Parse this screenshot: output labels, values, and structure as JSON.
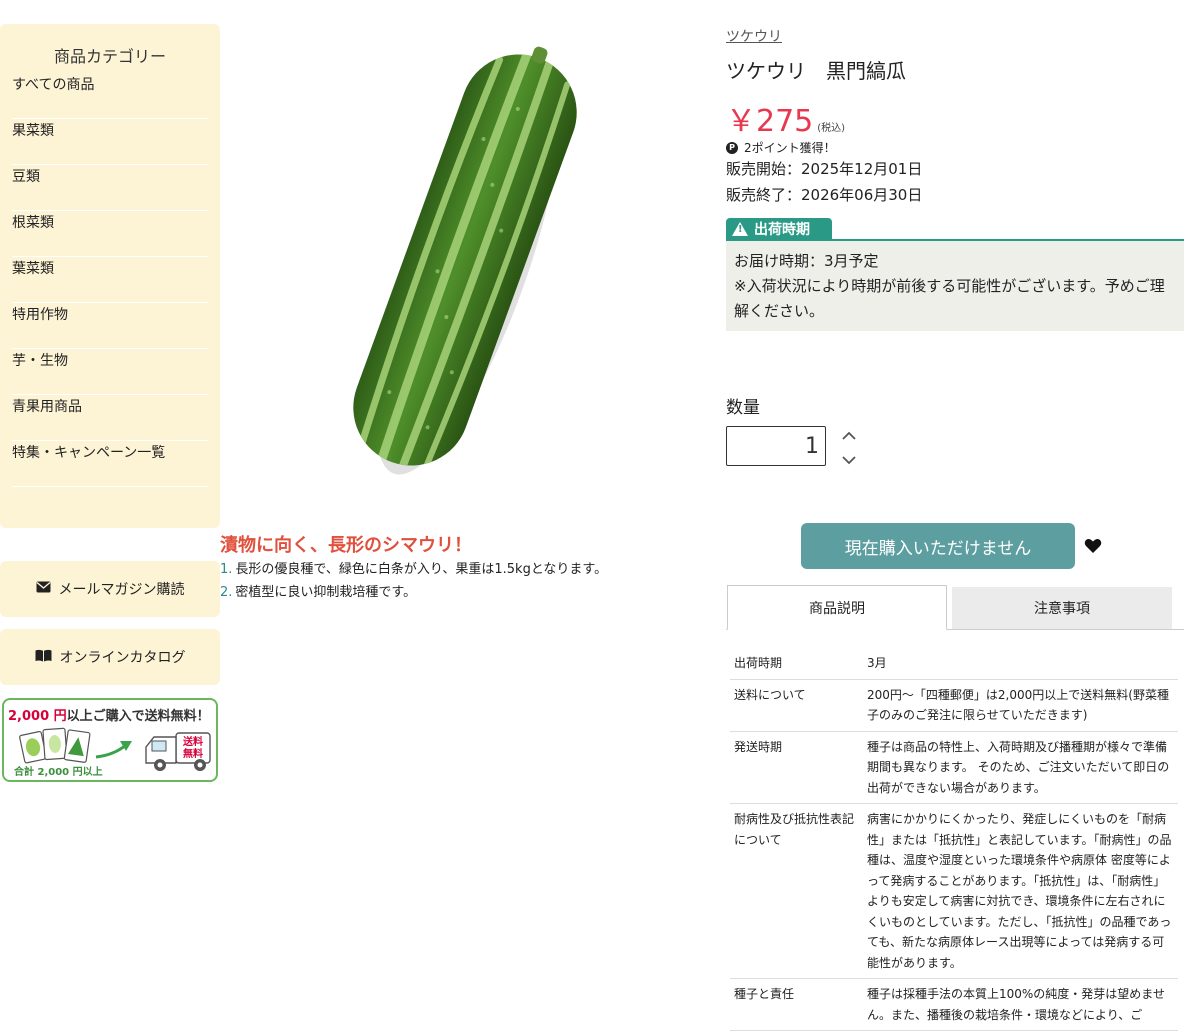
{
  "sidebar": {
    "title": "商品カテゴリー",
    "categories": [
      "すべての商品",
      "果菜類",
      "豆類",
      "根菜類",
      "葉菜類",
      "特用作物",
      "芋・生物",
      "青果用商品",
      "特集・キャンペーン一覧"
    ],
    "newsletter_label": "メールマガジン購読",
    "catalog_label": "オンラインカタログ",
    "banner": {
      "amount": "2,000 円",
      "text": "以上ご購入で送料無料！",
      "truck_text_1": "送料",
      "truck_text_2": "無料",
      "sub": "合計 2,000 円以上"
    }
  },
  "product": {
    "breadcrumb": "ツケウリ",
    "title": "ツケウリ　黒門縞瓜",
    "price": "￥275",
    "tax_note": "(税込)",
    "points": "2ポイント獲得！",
    "points_icon": "P",
    "sale_start": "販売開始：2025年12月01日",
    "sale_end": "販売終了：2026年06月30日",
    "shipping_tab": "出荷時期",
    "delivery_line1": "お届け時期：3月予定",
    "delivery_line2": "※入荷状況により時期が前後する可能性がございます。予めご理解ください。",
    "quantity_label": "数量",
    "quantity_value": "1",
    "buy_button": "現在購入いただけません",
    "tagline": "漬物に向く、長形のシマウリ！",
    "features": [
      {
        "num": "1.",
        "text": "長形の優良種で、緑色に白条が入り、果重は1.5kgとなります。"
      },
      {
        "num": "2.",
        "text": "密植型に良い抑制栽培種です。"
      }
    ]
  },
  "tabs": [
    "商品説明",
    "注意事項"
  ],
  "specs": [
    {
      "key": "出荷時期",
      "value": "3月"
    },
    {
      "key": "送料について",
      "value": "200円〜「四種郵便」は2,000円以上で送料無料(野菜種子のみのご発注に限らせていただきます)"
    },
    {
      "key": "発送時期",
      "value": "種子は商品の特性上、入荷時期及び播種期が様々で準備期間も異なります。 そのため、ご注文いただいて即日の出荷ができない場合があります。"
    },
    {
      "key": "耐病性及び抵抗性表記について",
      "value": "病害にかかりにくかったり、発症しにくいものを「耐病性」または「抵抗性」と表記しています。「耐病性」の品種は、温度や湿度といった環境条件や病原体 密度等によって発病することがあります。「抵抗性」は、「耐病性」よりも安定して病害に対抗でき、環境条件に左右されにくいものとしています。ただし、「抵抗性」の品種であっても、新たな病原体レース出現等によっては発病する可能性があります。"
    },
    {
      "key": "種子と責任",
      "value": "種子は採種手法の本質上100%の純度・発芽は望めません。また、播種後の栽培条件・環境などにより、ご"
    }
  ],
  "colors": {
    "sidebar_bg": "#fdf4d6",
    "price_red": "#e8384f",
    "accent_teal": "#2a9a86",
    "buy_button_bg": "#5d9fa1",
    "tagline_red": "#e0503c"
  },
  "icons": {
    "newsletter": "envelope-icon",
    "catalog": "book-icon",
    "favorite": "heart-icon",
    "warning": "warning-icon"
  }
}
